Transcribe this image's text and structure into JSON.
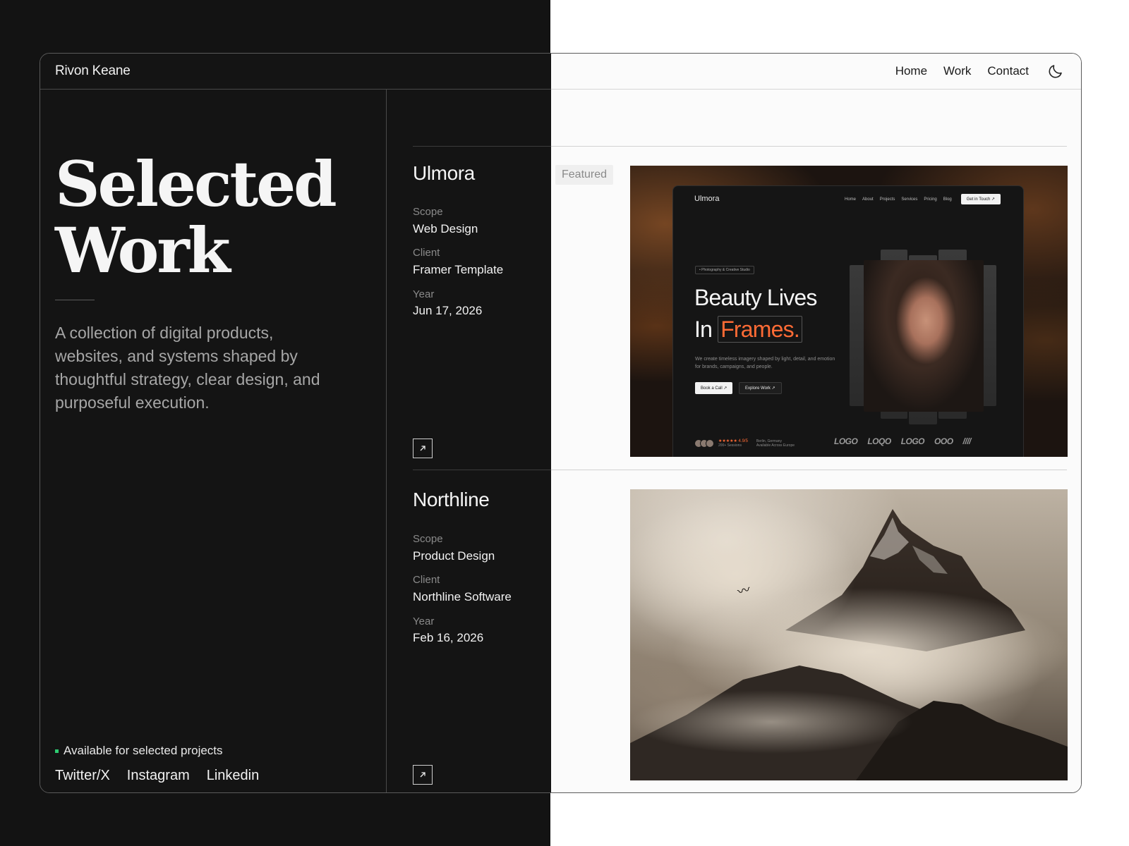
{
  "header": {
    "brand": "Rivon Keane",
    "nav": [
      "Home",
      "Work",
      "Contact"
    ],
    "theme_toggle_icon": "moon-icon"
  },
  "hero": {
    "title_line1": "Selected",
    "title_line2": "Work",
    "description": "A collection of digital products, websites, and systems shaped by thoughtful strategy, clear design, and purposeful execution."
  },
  "footer": {
    "availability": "Available for selected projects",
    "availability_color": "#2ecc71",
    "socials": [
      "Twitter/X",
      "Instagram",
      "Linkedin"
    ]
  },
  "projects": [
    {
      "name": "Ulmora",
      "badge": "Featured",
      "scope_label": "Scope",
      "scope": "Web Design",
      "client_label": "Client",
      "client": "Framer Template",
      "year_label": "Year",
      "year": "Jun 17, 2026",
      "link_icon": "arrow-up-right-icon",
      "preview": {
        "brand": "Ulmora",
        "nav": [
          "Home",
          "About",
          "Projects",
          "Services",
          "Pricing",
          "Blog"
        ],
        "cta": "Get in Touch ↗",
        "tag": "• Photography & Creative Studio",
        "headline_line1": "Beauty Lives",
        "headline_line2_prefix": "In",
        "headline_line2_accent": "Frames.",
        "accent_color": "#ff6b35",
        "subtext": "We create timeless imagery shaped by light, detail, and emotion for brands, campaigns, and people.",
        "button_primary": "Book a Call ↗",
        "button_secondary": "Explore Work ↗",
        "rating": "★★★★★ 4.9/5",
        "sessions": "200+ Sessions",
        "location": "Berlin, Germany",
        "availability": "Available Across Europe",
        "logos": [
          "LOGO",
          "LOQO",
          "LOGO",
          "OOO",
          "////"
        ]
      }
    },
    {
      "name": "Northline",
      "scope_label": "Scope",
      "scope": "Product Design",
      "client_label": "Client",
      "client": "Northline Software",
      "year_label": "Year",
      "year": "Feb 16, 2026",
      "link_icon": "arrow-up-right-icon"
    }
  ]
}
